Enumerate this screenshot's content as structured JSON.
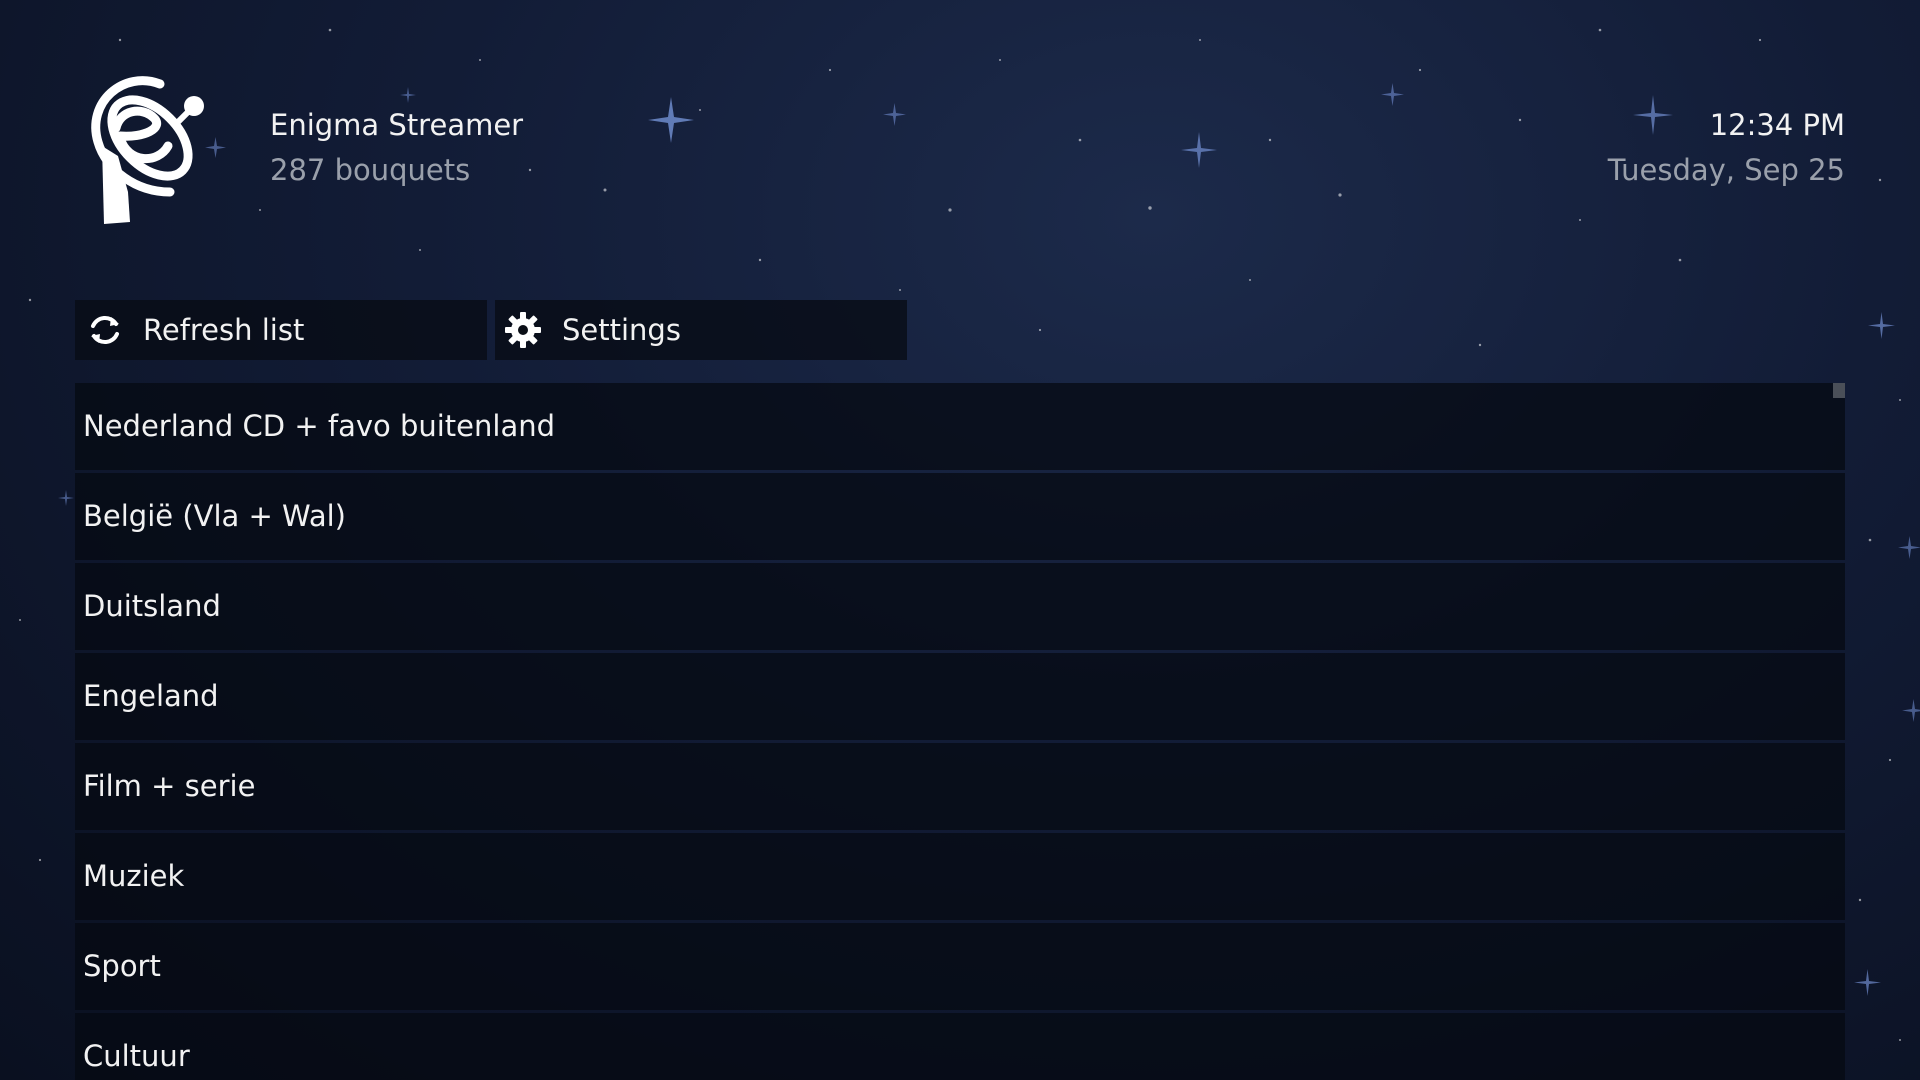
{
  "header": {
    "logo_icon": "enigma-satellite-logo-icon",
    "app_title": "Enigma Streamer",
    "subtitle": "287 bouquets",
    "time": "12:34 PM",
    "date": "Tuesday, Sep 25"
  },
  "toolbar": {
    "refresh": {
      "icon": "refresh-icon",
      "label": "Refresh list"
    },
    "settings": {
      "icon": "gear-icon",
      "label": "Settings"
    }
  },
  "bouquets": [
    {
      "label": "Nederland CD + favo buitenland"
    },
    {
      "label": "België (Vla + Wal)"
    },
    {
      "label": "Duitsland"
    },
    {
      "label": "Engeland"
    },
    {
      "label": "Film + serie"
    },
    {
      "label": "Muziek"
    },
    {
      "label": "Sport"
    },
    {
      "label": "Cultuur"
    }
  ],
  "colors": {
    "background": "#121c36",
    "panel": "#060a12",
    "text_primary": "#f2f2f2",
    "text_secondary": "#9aa0ab"
  }
}
